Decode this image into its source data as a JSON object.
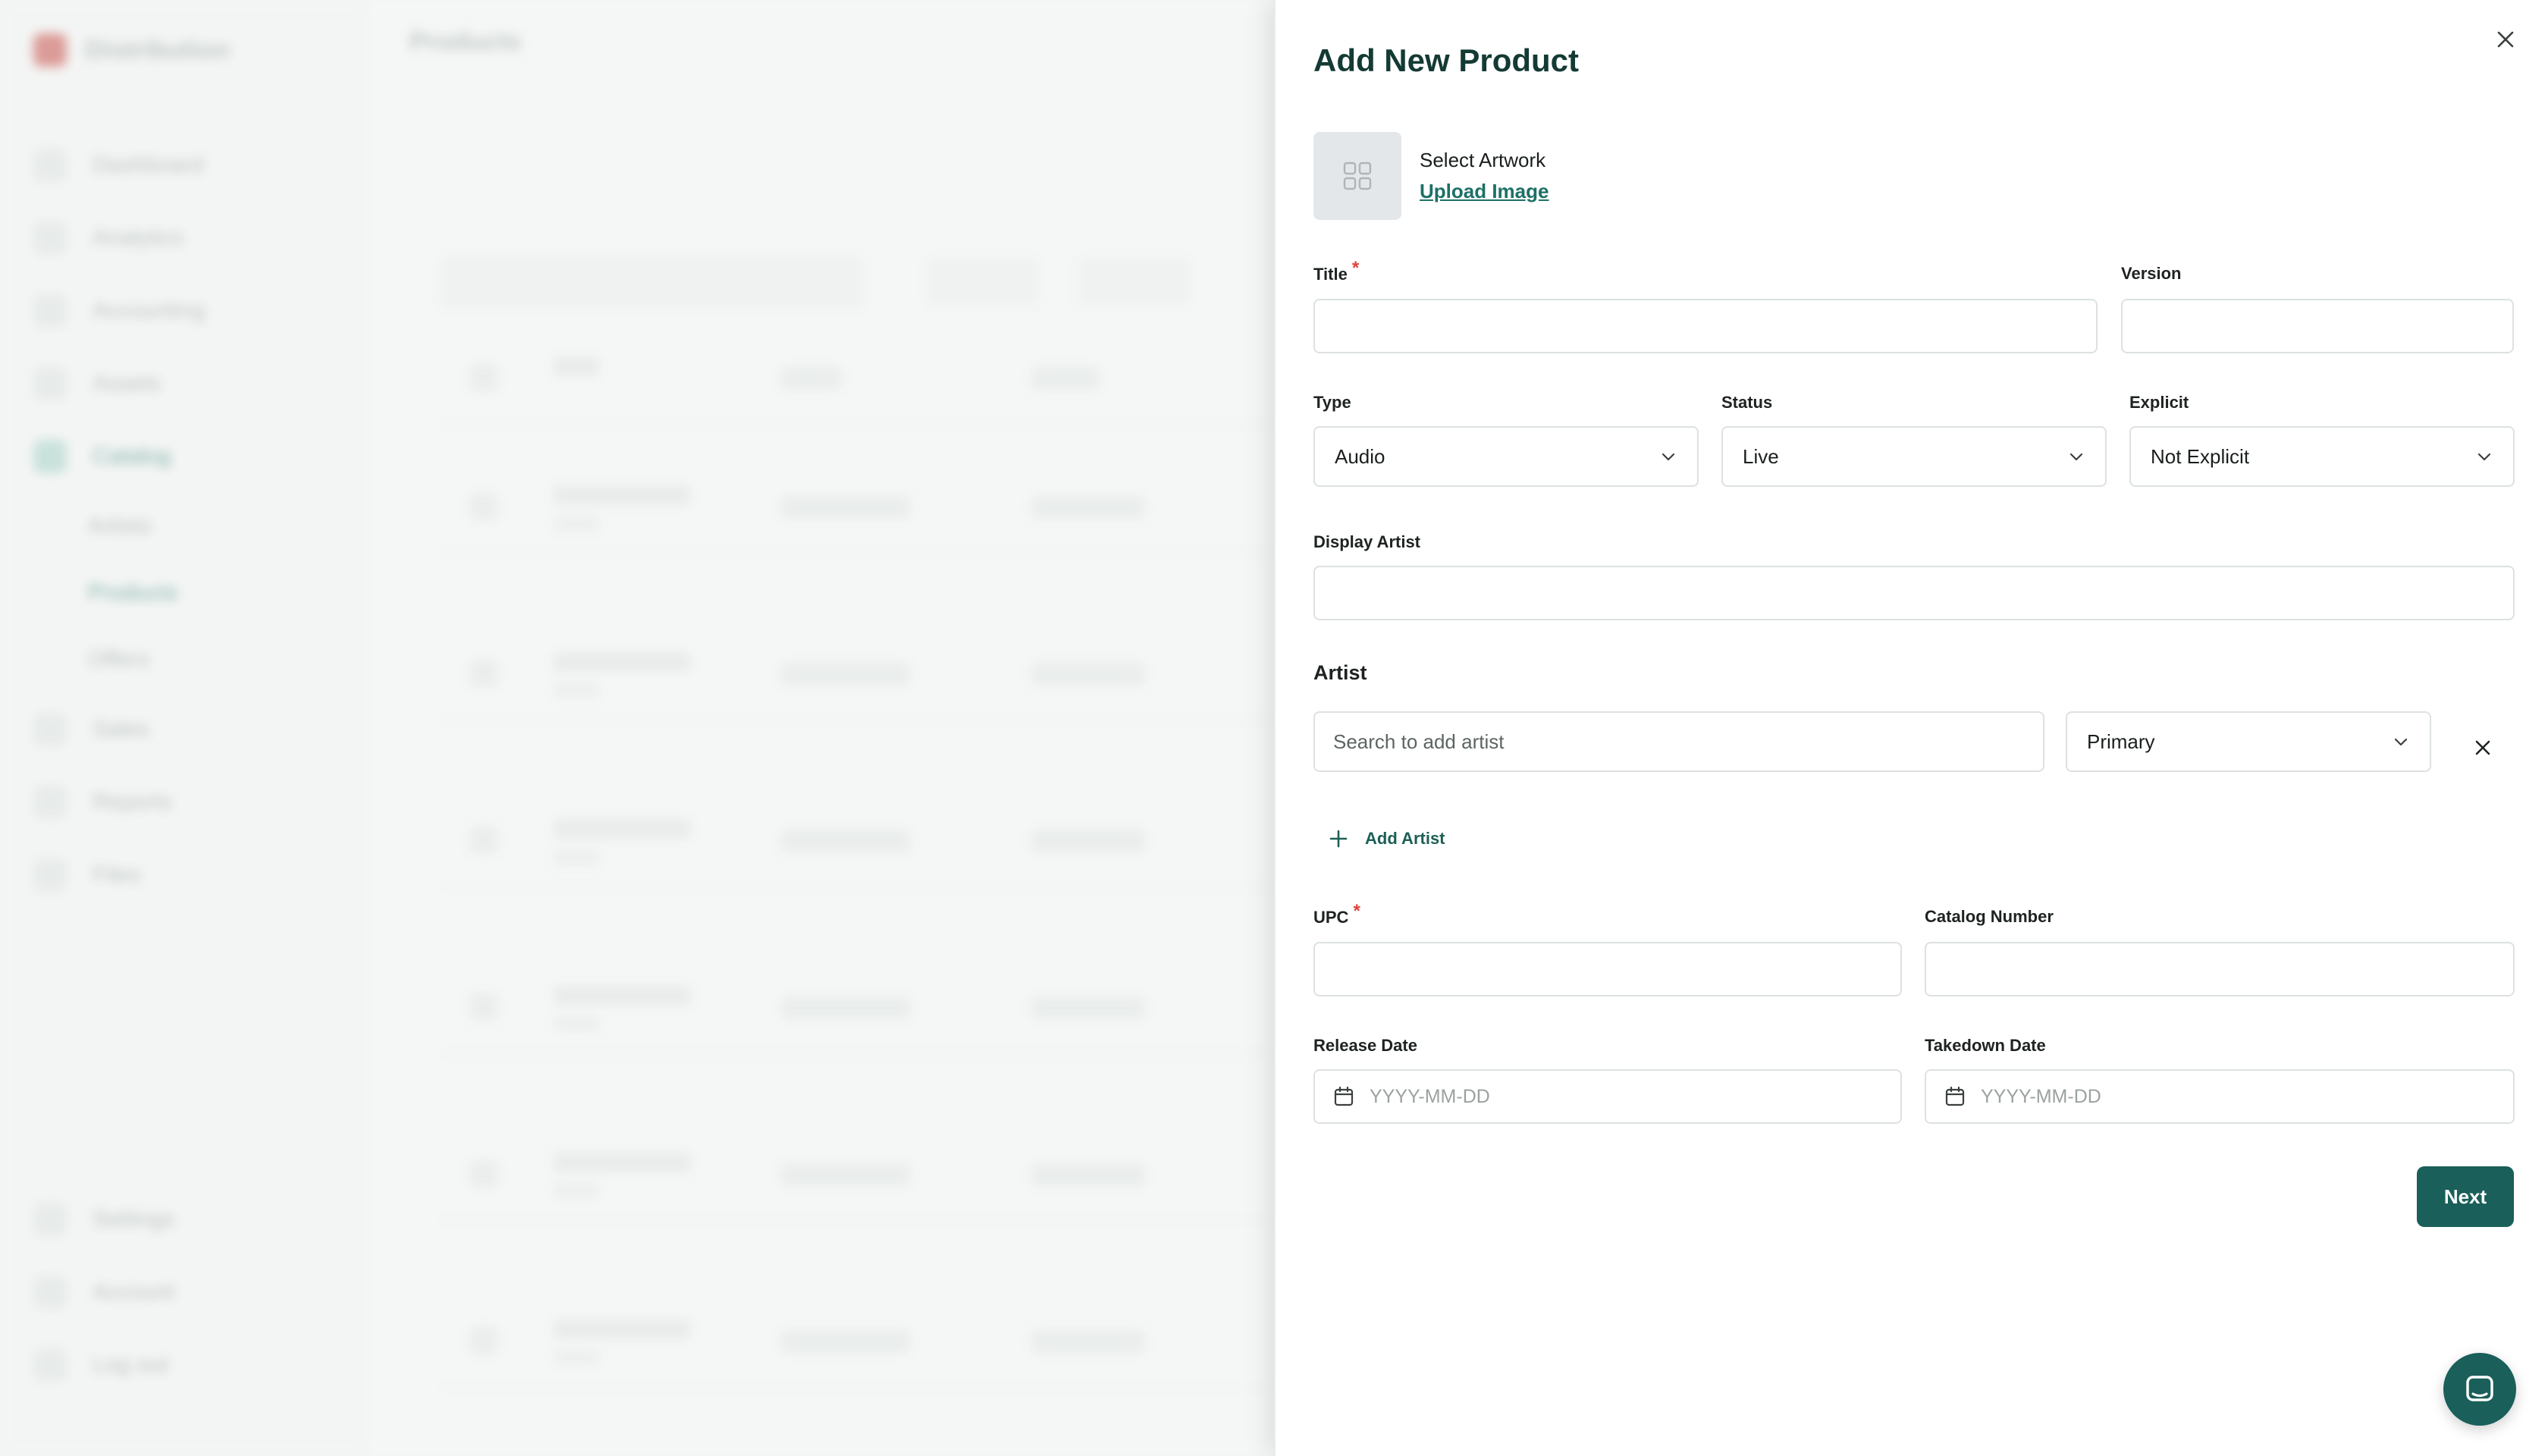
{
  "background": {
    "app_name": "Distribution",
    "page_title": "Products",
    "nav": [
      "Dashboard",
      "Analytics",
      "Accounting",
      "Assets",
      "Catalog",
      "Artists",
      "Products",
      "Offers",
      "Sales",
      "Reports",
      "Files"
    ],
    "nav_bottom": [
      "Settings",
      "Account",
      "Log out"
    ]
  },
  "drawer": {
    "title": "Add New Product",
    "artwork": {
      "label": "Select Artwork",
      "upload_link": "Upload Image"
    },
    "fields": {
      "title_label": "Title",
      "version_label": "Version",
      "type_label": "Type",
      "type_value": "Audio",
      "status_label": "Status",
      "status_value": "Live",
      "explicit_label": "Explicit",
      "explicit_value": "Not Explicit",
      "display_artist_label": "Display Artist",
      "artist_section": "Artist",
      "artist_search_placeholder": "Search to add artist",
      "artist_role_value": "Primary",
      "add_artist_label": "Add Artist",
      "upc_label": "UPC",
      "catalog_number_label": "Catalog Number",
      "release_date_label": "Release Date",
      "release_date_placeholder": "YYYY-MM-DD",
      "takedown_date_label": "Takedown Date",
      "takedown_date_placeholder": "YYYY-MM-DD",
      "required_marker": "*"
    },
    "next_label": "Next"
  },
  "colors": {
    "brand": "#1a5f59",
    "title": "#143a34",
    "required": "#e0403a",
    "link": "#1d7067"
  },
  "icons": {
    "close": "close-icon",
    "artwork": "image-grid-icon",
    "chevron": "chevron-down-icon",
    "plus": "plus-icon",
    "calendar": "calendar-icon",
    "chat": "chat-icon"
  }
}
